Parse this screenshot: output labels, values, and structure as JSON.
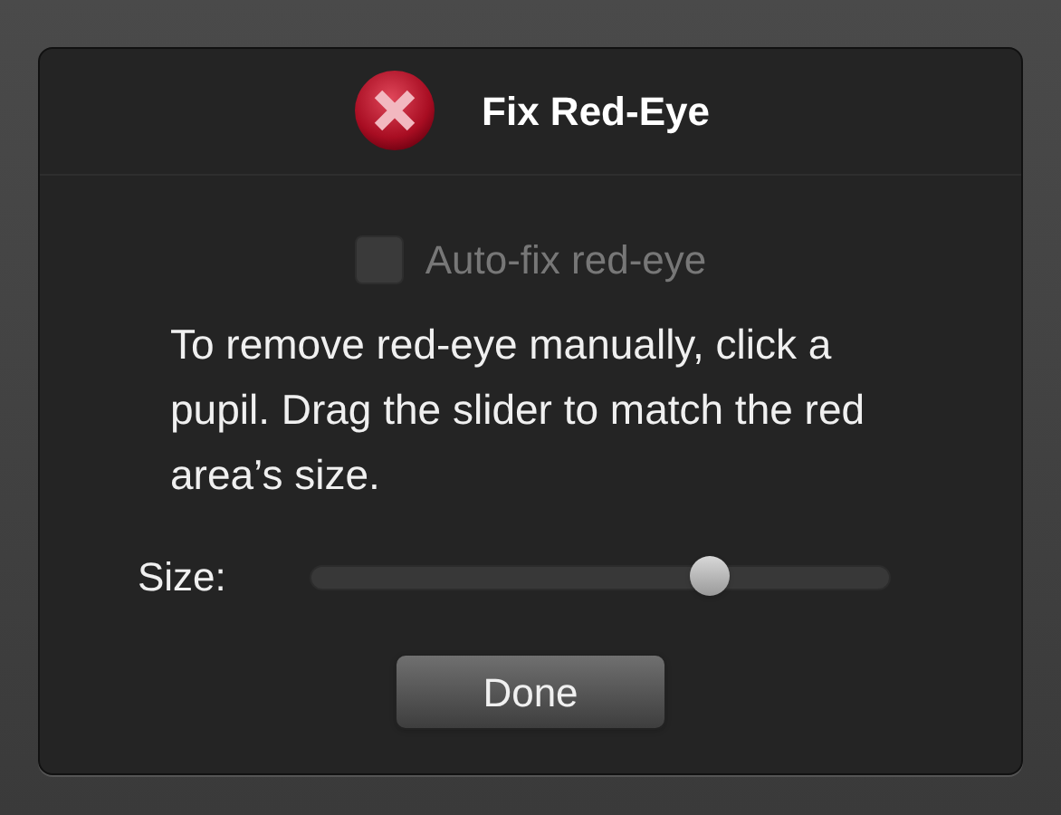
{
  "window": {
    "title": "Fix Red-Eye"
  },
  "auto_fix": {
    "label": "Auto-fix red-eye",
    "checked": false,
    "disabled": true
  },
  "instructions": "To remove red-eye manually, click a pupil. Drag the slider to match the red area’s size.",
  "size_slider": {
    "label": "Size:",
    "level": 0.69
  },
  "buttons": [
    "Done"
  ]
}
